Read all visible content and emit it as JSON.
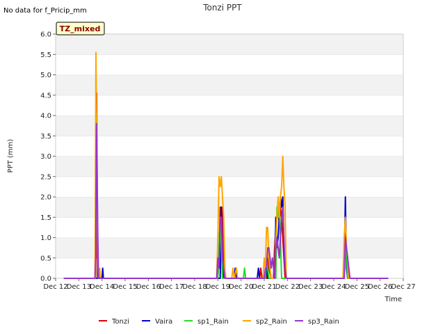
{
  "note": "No data for f_Pricip_mm",
  "badge": "TZ_mixed",
  "chart_data": {
    "type": "line",
    "title": "Tonzi PPT",
    "xlabel": "Time",
    "ylabel": "PPT (mm)",
    "ylim": [
      0,
      6
    ],
    "yticks": [
      "0.0",
      "0.5",
      "1.0",
      "1.5",
      "2.0",
      "2.5",
      "3.0",
      "3.5",
      "4.0",
      "4.5",
      "5.0",
      "5.5",
      "6.0"
    ],
    "xlim": [
      12,
      27
    ],
    "xticks": [
      {
        "v": 12,
        "label": "Dec 12"
      },
      {
        "v": 13,
        "label": "Dec 13"
      },
      {
        "v": 14,
        "label": "Dec 14"
      },
      {
        "v": 15,
        "label": "Dec 15"
      },
      {
        "v": 16,
        "label": "Dec 16"
      },
      {
        "v": 17,
        "label": "Dec 17"
      },
      {
        "v": 18,
        "label": "Dec 18"
      },
      {
        "v": 19,
        "label": "Dec 19"
      },
      {
        "v": 20,
        "label": "Dec 20"
      },
      {
        "v": 21,
        "label": "Dec 21"
      },
      {
        "v": 22,
        "label": "Dec 22"
      },
      {
        "v": 23,
        "label": "Dec 23"
      },
      {
        "v": 24,
        "label": "Dec 24"
      },
      {
        "v": 25,
        "label": "Dec 25"
      },
      {
        "v": 26,
        "label": "Dec 26"
      },
      {
        "v": 27,
        "label": "Dec 27"
      }
    ],
    "grid": true,
    "legend": "bottom",
    "series": [
      {
        "name": "Tonzi",
        "color": "#dd0000",
        "points": [
          [
            12.35,
            0
          ],
          [
            13.7,
            0
          ],
          [
            13.72,
            1.25
          ],
          [
            13.75,
            0.5
          ],
          [
            13.77,
            4.55
          ],
          [
            13.8,
            0
          ],
          [
            13.85,
            0.25
          ],
          [
            13.9,
            0
          ],
          [
            19.0,
            0
          ],
          [
            19.05,
            0.5
          ],
          [
            19.1,
            1.75
          ],
          [
            19.15,
            1.5
          ],
          [
            19.2,
            1.75
          ],
          [
            19.25,
            0.5
          ],
          [
            19.3,
            0
          ],
          [
            20.8,
            0
          ],
          [
            20.85,
            0.25
          ],
          [
            20.9,
            0
          ],
          [
            21.1,
            0
          ],
          [
            21.15,
            0.5
          ],
          [
            21.2,
            0.25
          ],
          [
            21.3,
            0
          ],
          [
            21.4,
            0
          ],
          [
            21.45,
            0.75
          ],
          [
            21.5,
            1.25
          ],
          [
            21.55,
            1.5
          ],
          [
            21.6,
            1.75
          ],
          [
            21.65,
            1.25
          ],
          [
            21.7,
            1.75
          ],
          [
            21.75,
            1.5
          ],
          [
            21.8,
            1.0
          ],
          [
            21.9,
            0
          ],
          [
            24.45,
            0
          ],
          [
            24.5,
            1.5
          ],
          [
            24.55,
            0.5
          ],
          [
            24.6,
            0
          ],
          [
            26.35,
            0
          ]
        ]
      },
      {
        "name": "Vaira",
        "color": "#0000cc",
        "points": [
          [
            12.35,
            0
          ],
          [
            14.0,
            0
          ],
          [
            14.03,
            0.25
          ],
          [
            14.06,
            0
          ],
          [
            19.1,
            0
          ],
          [
            19.15,
            1.75
          ],
          [
            19.2,
            0.25
          ],
          [
            19.25,
            0
          ],
          [
            19.7,
            0
          ],
          [
            19.75,
            0.25
          ],
          [
            19.8,
            0
          ],
          [
            20.7,
            0
          ],
          [
            20.75,
            0.25
          ],
          [
            20.8,
            0
          ],
          [
            21.05,
            0
          ],
          [
            21.1,
            0.25
          ],
          [
            21.15,
            0
          ],
          [
            21.45,
            0
          ],
          [
            21.5,
            1.5
          ],
          [
            21.55,
            0.75
          ],
          [
            21.6,
            1.0
          ],
          [
            21.65,
            1.5
          ],
          [
            21.7,
            2.0
          ],
          [
            21.75,
            1.75
          ],
          [
            21.8,
            2.0
          ],
          [
            21.85,
            0.75
          ],
          [
            21.9,
            0.25
          ],
          [
            21.95,
            0
          ],
          [
            24.45,
            0
          ],
          [
            24.5,
            2.0
          ],
          [
            24.55,
            0.25
          ],
          [
            24.6,
            0
          ],
          [
            26.35,
            0
          ]
        ]
      },
      {
        "name": "sp1_Rain",
        "color": "#22dd22",
        "points": [
          [
            12.35,
            0
          ],
          [
            13.72,
            0
          ],
          [
            13.75,
            3.0
          ],
          [
            13.78,
            4.05
          ],
          [
            13.81,
            1.0
          ],
          [
            13.84,
            0
          ],
          [
            19.0,
            0
          ],
          [
            19.1,
            1.5
          ],
          [
            19.15,
            0.75
          ],
          [
            19.2,
            0
          ],
          [
            20.1,
            0
          ],
          [
            20.15,
            0.25
          ],
          [
            20.2,
            0
          ],
          [
            21.05,
            0
          ],
          [
            21.1,
            0.5
          ],
          [
            21.15,
            0.25
          ],
          [
            21.2,
            0
          ],
          [
            21.5,
            0
          ],
          [
            21.55,
            1.75
          ],
          [
            21.6,
            1.5
          ],
          [
            21.65,
            1.75
          ],
          [
            21.7,
            1.0
          ],
          [
            21.75,
            0
          ],
          [
            24.4,
            0
          ],
          [
            24.5,
            1.0
          ],
          [
            24.6,
            0
          ],
          [
            26.35,
            0
          ]
        ]
      },
      {
        "name": "sp2_Rain",
        "color": "#ffa500",
        "points": [
          [
            12.35,
            0
          ],
          [
            13.7,
            0
          ],
          [
            13.74,
            5.55
          ],
          [
            13.78,
            2.5
          ],
          [
            13.82,
            0.25
          ],
          [
            13.86,
            0
          ],
          [
            13.9,
            0.25
          ],
          [
            13.94,
            0
          ],
          [
            18.95,
            0
          ],
          [
            19.0,
            1.0
          ],
          [
            19.05,
            2.5
          ],
          [
            19.1,
            2.25
          ],
          [
            19.15,
            2.5
          ],
          [
            19.2,
            2.0
          ],
          [
            19.25,
            1.5
          ],
          [
            19.3,
            0.25
          ],
          [
            19.35,
            0
          ],
          [
            19.6,
            0
          ],
          [
            19.65,
            0.25
          ],
          [
            19.7,
            0
          ],
          [
            19.8,
            0.25
          ],
          [
            19.85,
            0
          ],
          [
            20.95,
            0
          ],
          [
            21.0,
            0.5
          ],
          [
            21.05,
            0.25
          ],
          [
            21.1,
            1.25
          ],
          [
            21.15,
            1.25
          ],
          [
            21.2,
            0.5
          ],
          [
            21.25,
            0.25
          ],
          [
            21.3,
            0
          ],
          [
            21.45,
            0
          ],
          [
            21.5,
            1.0
          ],
          [
            21.55,
            1.5
          ],
          [
            21.6,
            2.0
          ],
          [
            21.65,
            1.5
          ],
          [
            21.7,
            2.0
          ],
          [
            21.75,
            2.25
          ],
          [
            21.8,
            3.0
          ],
          [
            21.85,
            2.25
          ],
          [
            21.9,
            1.75
          ],
          [
            21.95,
            0
          ],
          [
            24.4,
            0
          ],
          [
            24.45,
            1.0
          ],
          [
            24.5,
            1.5
          ],
          [
            24.55,
            0.75
          ],
          [
            24.6,
            0.5
          ],
          [
            24.65,
            0
          ],
          [
            26.35,
            0
          ]
        ]
      },
      {
        "name": "sp3_Rain",
        "color": "#9932cc",
        "points": [
          [
            12.35,
            0
          ],
          [
            13.7,
            0
          ],
          [
            13.73,
            0.5
          ],
          [
            13.76,
            3.8
          ],
          [
            13.79,
            2.5
          ],
          [
            13.82,
            1.0
          ],
          [
            13.85,
            0
          ],
          [
            18.95,
            0
          ],
          [
            19.0,
            0.5
          ],
          [
            19.05,
            0.25
          ],
          [
            19.1,
            1.5
          ],
          [
            19.15,
            1.5
          ],
          [
            19.2,
            0.5
          ],
          [
            19.25,
            0.25
          ],
          [
            19.3,
            0
          ],
          [
            21.0,
            0
          ],
          [
            21.05,
            0.25
          ],
          [
            21.1,
            0.25
          ],
          [
            21.15,
            0.75
          ],
          [
            21.2,
            0.75
          ],
          [
            21.25,
            0.5
          ],
          [
            21.3,
            0.25
          ],
          [
            21.35,
            0.5
          ],
          [
            21.4,
            0.25
          ],
          [
            21.45,
            0
          ],
          [
            21.5,
            0.75
          ],
          [
            21.55,
            1.0
          ],
          [
            21.6,
            0.75
          ],
          [
            21.65,
            0.5
          ],
          [
            21.7,
            1.0
          ],
          [
            21.75,
            1.5
          ],
          [
            21.8,
            1.75
          ],
          [
            21.85,
            1.0
          ],
          [
            21.9,
            0.25
          ],
          [
            21.95,
            0
          ],
          [
            24.45,
            0
          ],
          [
            24.5,
            1.0
          ],
          [
            24.55,
            0.75
          ],
          [
            24.6,
            0.5
          ],
          [
            24.65,
            0.25
          ],
          [
            24.7,
            0
          ],
          [
            26.35,
            0
          ]
        ]
      }
    ]
  }
}
